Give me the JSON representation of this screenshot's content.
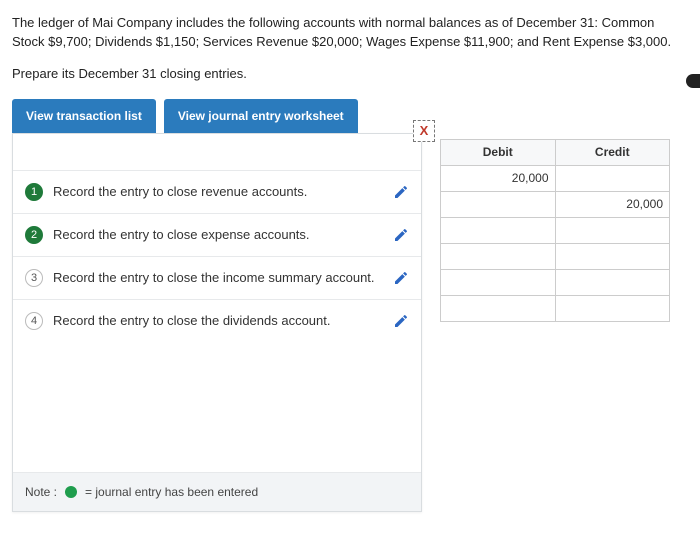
{
  "intro": "The ledger of Mai Company includes the following accounts with normal balances as of December 31: Common Stock $9,700; Dividends $1,150; Services Revenue $20,000; Wages Expense $11,900; and Rent Expense $3,000.",
  "prepare": "Prepare its December 31 closing entries.",
  "tabs": {
    "transaction_list": "View transaction list",
    "journal_worksheet": "View journal entry worksheet"
  },
  "close_glyph": "X",
  "entries": [
    {
      "num": "1",
      "done": true,
      "text": "Record the entry to close revenue accounts."
    },
    {
      "num": "2",
      "done": true,
      "text": "Record the entry to close expense accounts."
    },
    {
      "num": "3",
      "done": false,
      "text": "Record the entry to close the income summary account."
    },
    {
      "num": "4",
      "done": false,
      "text": "Record the entry to close the dividends account."
    }
  ],
  "note": {
    "label": "Note :",
    "legend": "= journal entry has been entered"
  },
  "table": {
    "headers": {
      "debit": "Debit",
      "credit": "Credit"
    },
    "rows": [
      {
        "debit": "20,000",
        "credit": ""
      },
      {
        "debit": "",
        "credit": "20,000"
      },
      {
        "debit": "",
        "credit": ""
      },
      {
        "debit": "",
        "credit": ""
      },
      {
        "debit": "",
        "credit": ""
      },
      {
        "debit": "",
        "credit": ""
      }
    ]
  }
}
